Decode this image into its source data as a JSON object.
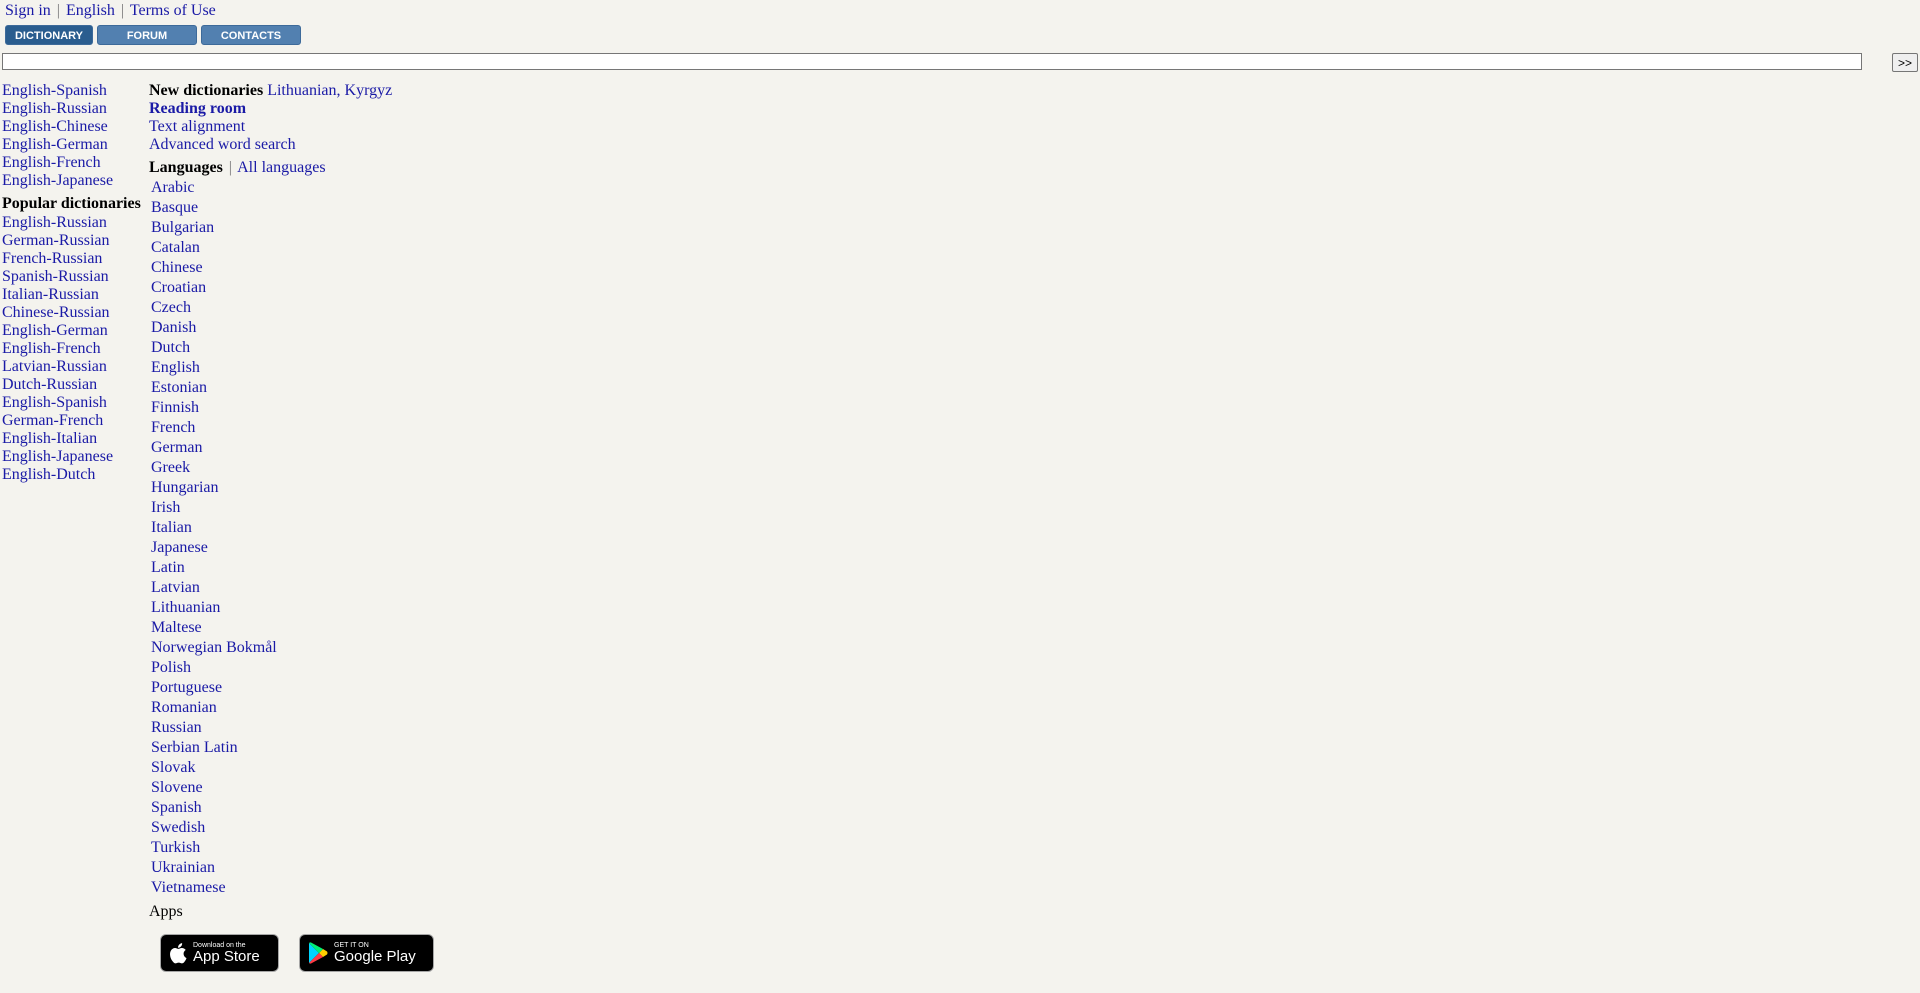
{
  "topbar": {
    "sign_in": "Sign in",
    "language": "English",
    "terms": "Terms of Use",
    "separator": "|"
  },
  "tabs": [
    {
      "label": "DICTIONARY",
      "active": true
    },
    {
      "label": "FORUM",
      "active": false
    },
    {
      "label": "CONTACTS",
      "active": false
    }
  ],
  "search": {
    "value": "",
    "button_label": ">>"
  },
  "left_links": [
    "English-Spanish",
    "English-Russian",
    "English-Chinese",
    "English-German",
    "English-French",
    "English-Japanese"
  ],
  "popular": {
    "heading": "Popular dictionaries",
    "items": [
      "English-Russian",
      "German-Russian",
      "French-Russian",
      "Spanish-Russian",
      "Italian-Russian",
      "Chinese-Russian",
      "English-German",
      "English-French",
      "Latvian-Russian",
      "Dutch-Russian",
      "English-Spanish",
      "German-French",
      "English-Italian",
      "English-Japanese",
      "English-Dutch"
    ]
  },
  "main": {
    "new_dicts_label": "New dictionaries",
    "new_dicts_value": "Lithuanian, Kyrgyz",
    "reading_room": "Reading room",
    "text_alignment": "Text alignment",
    "advanced_search": "Advanced word search",
    "languages_label": "Languages",
    "all_languages": "All languages",
    "separator": "|",
    "languages": [
      "Arabic",
      "Basque",
      "Bulgarian",
      "Catalan",
      "Chinese",
      "Croatian",
      "Czech",
      "Danish",
      "Dutch",
      "English",
      "Estonian",
      "Finnish",
      "French",
      "German",
      "Greek",
      "Hungarian",
      "Irish",
      "Italian",
      "Japanese",
      "Latin",
      "Latvian",
      "Lithuanian",
      "Maltese",
      "Norwegian Bokmål",
      "Polish",
      "Portuguese",
      "Romanian",
      "Russian",
      "Serbian Latin",
      "Slovak",
      "Slovene",
      "Spanish",
      "Swedish",
      "Turkish",
      "Ukrainian",
      "Vietnamese"
    ],
    "apps_label": "Apps"
  },
  "badges": {
    "apple": {
      "small": "Download on the",
      "big": "App Store"
    },
    "google": {
      "small": "GET IT ON",
      "big": "Google Play"
    }
  },
  "colors": {
    "link": "#1a1aa6",
    "background": "#f4f3ee",
    "tab": "#5280b0",
    "tab_active": "#2a5d8f"
  }
}
